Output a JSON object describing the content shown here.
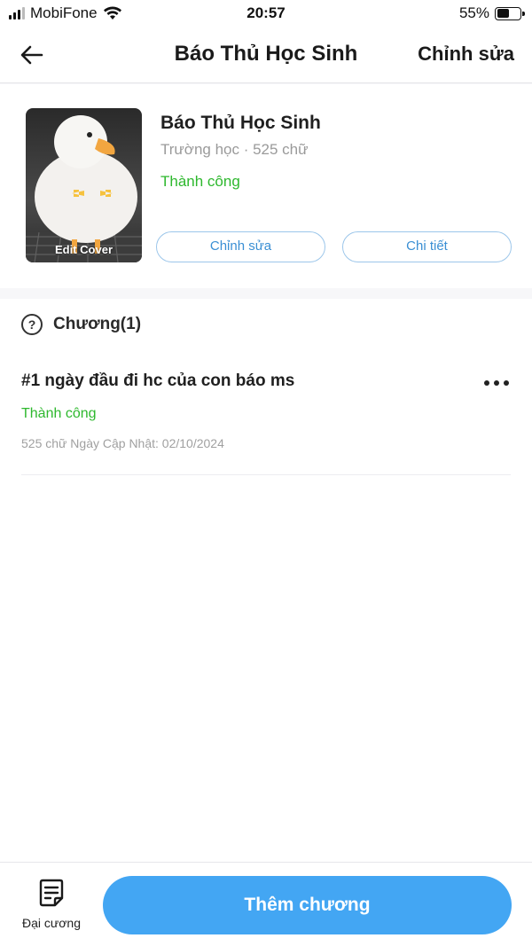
{
  "status_bar": {
    "carrier": "MobiFone",
    "time": "20:57",
    "battery_percent": "55%",
    "battery_level": 0.55
  },
  "header": {
    "title": "Báo Thủ Học Sinh",
    "action_label": "Chỉnh sửa",
    "back_icon": "arrow-left-icon"
  },
  "book": {
    "cover_label": "Edit Cover",
    "title": "Báo Thủ Học Sinh",
    "meta": "Trường học · 525 chữ",
    "status": "Thành công",
    "edit_button": "Chỉnh sửa",
    "detail_button": "Chi tiết"
  },
  "chapters": {
    "help_icon": "question-circle-icon",
    "help_glyph": "?",
    "title": "Chương(1)",
    "items": [
      {
        "name": "#1 ngày đầu đi hc của con báo ms",
        "status": "Thành công",
        "info": "525 chữ Ngày Cập Nhật: 02/10/2024"
      }
    ]
  },
  "bottom_bar": {
    "outline_icon": "document-list-icon",
    "outline_label": "Đại cương",
    "add_button": "Thêm chương"
  },
  "colors": {
    "success": "#2eb82e",
    "accent": "#43a6f3",
    "outline_button": "#3a8fd4"
  }
}
